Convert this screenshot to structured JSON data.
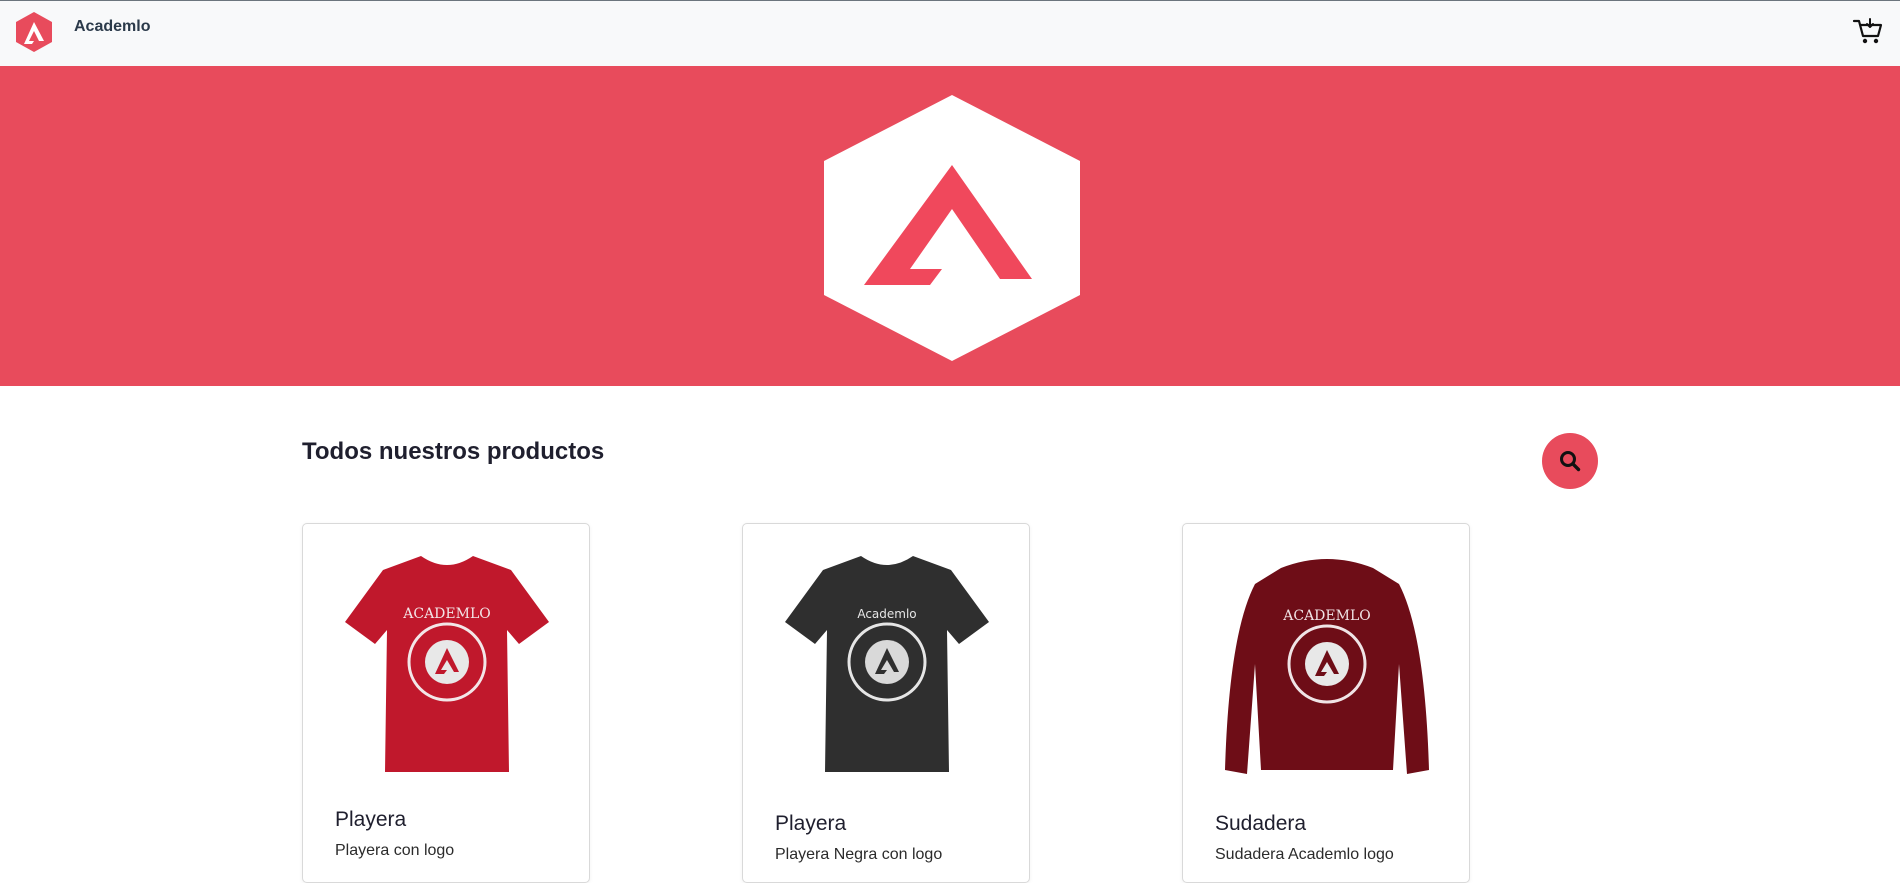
{
  "header": {
    "brand": "Academlo",
    "logo_icon": "academlo-logo-icon",
    "cart_icon": "cart-icon"
  },
  "hero": {
    "background": "#e84b5c",
    "logo_icon": "academlo-hexagon-logo"
  },
  "main": {
    "title": "Todos nuestros productos",
    "search_icon": "search-icon",
    "products": [
      {
        "title": "Playera",
        "description": "Playera con logo",
        "color": "#c0182c"
      },
      {
        "title": "Playera",
        "description": "Playera Negra con logo",
        "color": "#2f2f2f"
      },
      {
        "title": "Sudadera",
        "description": "Sudadera Academlo logo",
        "color": "#6e0d17"
      }
    ]
  },
  "colors": {
    "accent": "#e84b5c",
    "navbar": "#f8f9fa"
  }
}
